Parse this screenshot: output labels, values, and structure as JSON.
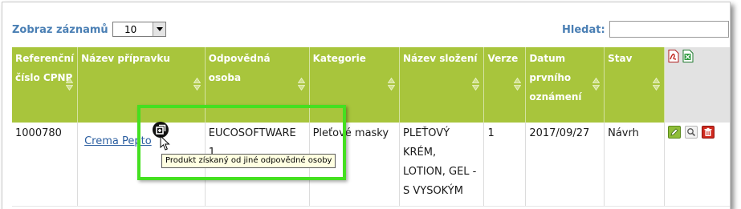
{
  "toolbar": {
    "records_label": "Zobraz záznamů",
    "page_size_value": "10",
    "search_label": "Hledat:",
    "search_value": ""
  },
  "table": {
    "columns": [
      "Referenční číslo CPNP",
      "Název přípravku",
      "Odpovědná osoba",
      "Kategorie",
      "Název složení",
      "Verze",
      "Datum prvního oznámení",
      "Stav"
    ],
    "rows": [
      {
        "ref": "1000780",
        "product": "Crema Pepto",
        "person": "EUCOSOFTWARE 1",
        "category": "Pleťové masky",
        "formulation": "PLEŤOVÝ KRÉM, LOTION, GEL - S VYSOKÝM",
        "version": "1",
        "date": "2017/09/27",
        "status": "Návrh"
      }
    ]
  },
  "tooltip": "Produkt získaný od jiné odpovědné osoby",
  "icons": {
    "export_pdf": "pdf-export-icon",
    "export_excel": "excel-export-icon",
    "edit": "edit-pencil-icon",
    "view": "magnifier-icon",
    "delete": "trash-icon",
    "transfer": "transferred-product-icon"
  },
  "colors": {
    "header_bg": "#a8c53c",
    "label_blue": "#4a7fb4",
    "highlight": "#44e020"
  }
}
